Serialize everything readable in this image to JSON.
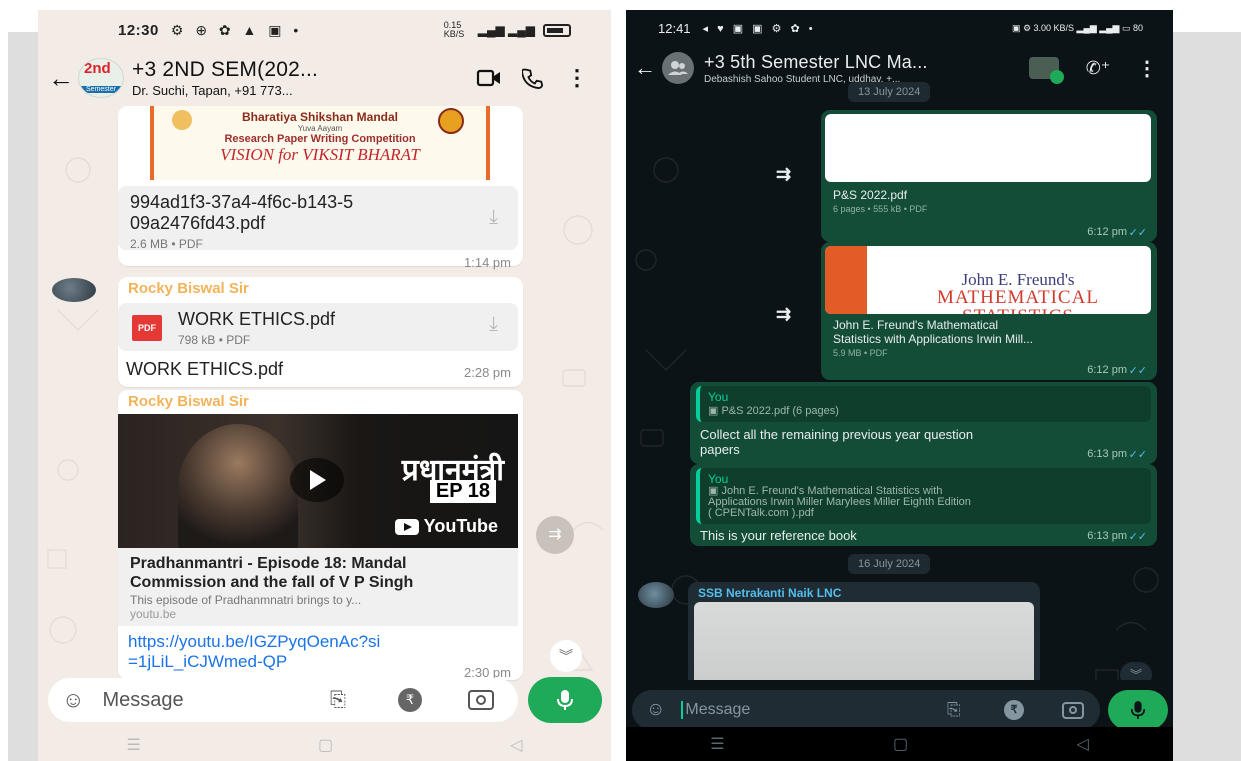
{
  "left": {
    "status": {
      "time": "12:30",
      "icons": "⚙ ⊕ ✿ ▲ ▣ •",
      "net": "0.15 KB/S",
      "signal": "▂▄▆ ▂▄▆"
    },
    "header": {
      "back_icon": "arrow-left",
      "avatar_badge": "2nd",
      "avatar_sub": "Semester",
      "title": "+3 2ND SEM(202...",
      "subtitle": "Dr. Suchi, Tapan, +91 773..."
    },
    "poster": {
      "line1": "Bharatiya Shikshan Mandal",
      "line2": "Yuva Aayam",
      "line3": "Research Paper Writing Competition",
      "line4": "VISION for VIKSIT BHARAT"
    },
    "msg1": {
      "file_name": "994ad1f3-37a4-4f6c-b143-509a2476fd43.pdf",
      "file_name_line1": "994ad1f3-37a4-4f6c-b143-5",
      "file_name_line2": "09a2476fd43.pdf",
      "file_meta": "2.6 MB • PDF",
      "time": "1:14 pm"
    },
    "msg2": {
      "sender": "Rocky Biswal Sir",
      "file_badge": "PDF",
      "file_name": "WORK ETHICS.pdf",
      "file_meta": "798 kB • PDF",
      "caption": "WORK ETHICS.pdf",
      "time": "2:28 pm"
    },
    "msg3": {
      "sender": "Rocky Biswal Sir",
      "thumb_hindi": "प्रधानमंत्री",
      "thumb_ep": "EP 18",
      "thumb_brand": "YouTube",
      "title": "Pradhanmantri - Episode 18: Mandal Commission and the fall of V P Singh",
      "desc": "This episode of Pradhanmnatri brings to y...",
      "domain": "youtu.be",
      "link_line1": "https://youtu.be/IGZPyqOenAc?si",
      "link_line2": "=1jLiL_iCJWmed-QP",
      "time": "2:30 pm"
    },
    "input": {
      "placeholder": "Message"
    },
    "colors": {
      "background": "#f3ece6",
      "bubble": "#ffffff",
      "sender": "#f3b35b",
      "link": "#1a73e8",
      "mic": "#1faa59"
    }
  },
  "right": {
    "status": {
      "time": "12:41",
      "icons": "◂ ♥ ▣ ▣ ⚙ ✿ •",
      "right": "▣ ⚙ 3.00 KB/S ▂▄▆ ▂▄▆ ▭ 80"
    },
    "header": {
      "title": "+3 5th Semester LNC Ma...",
      "subtitle": "Debashish Sahoo Student LNC, uddhav, +..."
    },
    "date1": "13 July 2024",
    "msg1": {
      "file_name": "P&S 2022.pdf",
      "file_meta": "6 pages • 555 kB • PDF",
      "time": "6:12 pm"
    },
    "msg2": {
      "book_line1": "John E. Freund's",
      "book_line2": "MATHEMATICAL",
      "book_line3": "STATISTICS",
      "file_name_line1": "John E. Freund's Mathematical",
      "file_name_line2": "Statistics with Applications Irwin Mill...",
      "file_meta": "5.9 MB • PDF",
      "time": "6:12 pm"
    },
    "msg3": {
      "quote_author": "You",
      "quote_text": "▣ P&S 2022.pdf (6 pages)",
      "text_line1": "Collect all the remaining previous year question",
      "text_line2": "papers",
      "time": "6:13 pm"
    },
    "msg4": {
      "quote_author": "You",
      "quote_line1": "▣ John E. Freund's Mathematical Statistics with",
      "quote_line2": "Applications Irwin Miller Marylees Miller Eighth Edition",
      "quote_line3": "( CPENTalk.com ).pdf",
      "text": "This is your reference book",
      "time": "6:13 pm"
    },
    "date2": "16 July 2024",
    "msg5": {
      "sender": "SSB Netrakanti Naik LNC"
    },
    "input": {
      "placeholder": "Message"
    },
    "colors": {
      "background": "#0c1317",
      "bubble": "#144d37",
      "accent": "#06cf9c",
      "mic": "#1faa59",
      "book_orange": "#e35b26",
      "book_red": "#d23b2c"
    }
  }
}
